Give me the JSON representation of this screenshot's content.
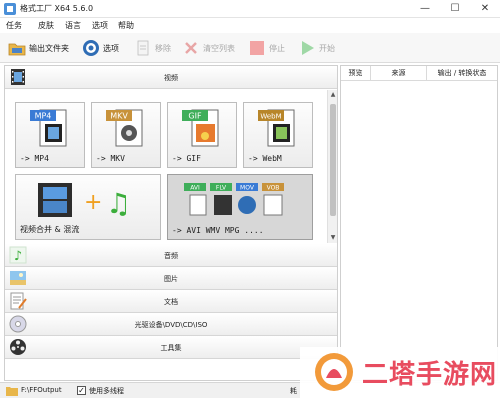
{
  "window": {
    "title": "格式工厂 X64 5.6.0"
  },
  "menu": [
    "任务",
    "皮肤",
    "语言",
    "选项",
    "帮助"
  ],
  "toolbar": {
    "output_folder": "输出文件夹",
    "options": "选项",
    "remove": "移除",
    "clear_list": "清空列表",
    "stop": "停止",
    "start": "开始"
  },
  "categories": {
    "video": "视频",
    "audio": "音频",
    "image": "图片",
    "document": "文档",
    "disc": "光驱设备\\DVD\\CD\\ISO",
    "tools": "工具集"
  },
  "video_tiles": {
    "mp4": {
      "badge": "MP4",
      "label": "-> MP4"
    },
    "mkv": {
      "badge": "MKV",
      "label": "-> MKV"
    },
    "gif": {
      "badge": "GIF",
      "label": "-> GIF"
    },
    "webm": {
      "badge": "WebM",
      "label": "-> WebM"
    },
    "merge": {
      "label": "视频合并 & 混流"
    },
    "multi": {
      "label": "-> AVI WMV MPG ....",
      "badges": [
        "AVI",
        "FLV",
        "MOV",
        "VOB"
      ]
    }
  },
  "task_columns": {
    "preview": "预览",
    "source": "来源",
    "output_status": "输出 / 转换状态"
  },
  "statusbar": {
    "output_path": "F:\\FFOutput",
    "multithread": "使用多线程",
    "right_text": "耗"
  },
  "watermark": {
    "text": "二塔手游网"
  },
  "colors": {
    "accent_green": "#3cb14a",
    "stop_red": "#e06060",
    "watermark_red": "#e84c5f"
  }
}
